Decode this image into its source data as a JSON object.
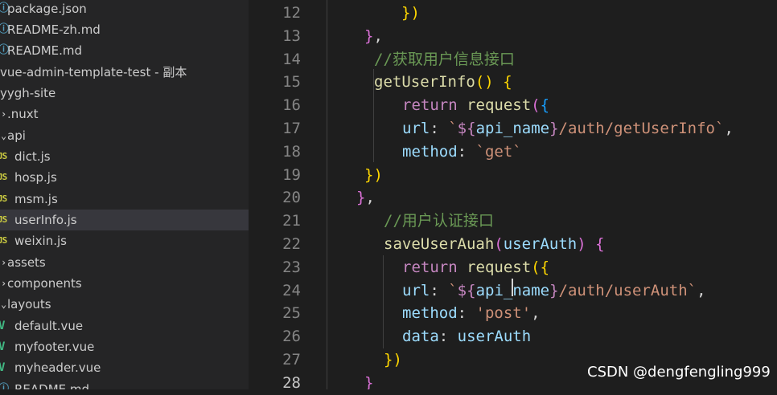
{
  "explorer": {
    "items": [
      {
        "label": "package.json",
        "icon": "info-icon",
        "selected": false
      },
      {
        "label": "README-zh.md",
        "icon": "info-icon",
        "selected": false
      },
      {
        "label": "README.md",
        "icon": "info-icon",
        "selected": false
      },
      {
        "label": "vue-admin-template-test - 副本",
        "icon": "",
        "selected": false
      },
      {
        "label": "yygh-site",
        "icon": "",
        "selected": false
      },
      {
        "label": ".nuxt",
        "icon": "chevron-right-icon",
        "selected": false
      },
      {
        "label": "api",
        "icon": "chevron-down-icon",
        "selected": false
      },
      {
        "label": "dict.js",
        "icon": "js-icon",
        "selected": false
      },
      {
        "label": "hosp.js",
        "icon": "js-icon",
        "selected": false
      },
      {
        "label": "msm.js",
        "icon": "js-icon",
        "selected": false
      },
      {
        "label": "userInfo.js",
        "icon": "js-icon",
        "selected": true
      },
      {
        "label": "weixin.js",
        "icon": "js-icon",
        "selected": false
      },
      {
        "label": "assets",
        "icon": "chevron-right-icon",
        "selected": false
      },
      {
        "label": "components",
        "icon": "chevron-right-icon",
        "selected": false
      },
      {
        "label": "layouts",
        "icon": "chevron-down-icon",
        "selected": false
      },
      {
        "label": "default.vue",
        "icon": "vue-icon",
        "selected": false
      },
      {
        "label": "myfooter.vue",
        "icon": "vue-icon",
        "selected": false
      },
      {
        "label": "myheader.vue",
        "icon": "vue-icon",
        "selected": false
      },
      {
        "label": "README.md",
        "icon": "info-icon",
        "selected": false
      }
    ]
  },
  "editor": {
    "active_line": "28",
    "lines": [
      {
        "num": "12",
        "tokens": [
          {
            "t": "})",
            "c": "b1"
          }
        ]
      },
      {
        "num": "13",
        "tokens": [
          {
            "t": "}",
            "c": "b2"
          },
          {
            "t": ",",
            "c": "p"
          }
        ]
      },
      {
        "num": "14",
        "tokens": [
          {
            "t": "//获取用户信息接口",
            "c": "cm"
          }
        ]
      },
      {
        "num": "15",
        "tokens": [
          {
            "t": "getUserInfo",
            "c": "fn"
          },
          {
            "t": "()",
            "c": "b1"
          },
          {
            "t": " ",
            "c": "p"
          },
          {
            "t": "{",
            "c": "b1"
          }
        ]
      },
      {
        "num": "16",
        "tokens": [
          {
            "t": "return",
            "c": "kw"
          },
          {
            "t": " ",
            "c": "p"
          },
          {
            "t": "request",
            "c": "fn"
          },
          {
            "t": "(",
            "c": "b2"
          },
          {
            "t": "{",
            "c": "b3"
          }
        ]
      },
      {
        "num": "17",
        "tokens": [
          {
            "t": "url",
            "c": "var"
          },
          {
            "t": ": ",
            "c": "p"
          },
          {
            "t": "`",
            "c": "str"
          },
          {
            "t": "${",
            "c": "kw"
          },
          {
            "t": "api_name",
            "c": "var"
          },
          {
            "t": "}",
            "c": "kw"
          },
          {
            "t": "/auth/getUserInfo`",
            "c": "str"
          },
          {
            "t": ",",
            "c": "p"
          }
        ]
      },
      {
        "num": "18",
        "tokens": [
          {
            "t": "method",
            "c": "var"
          },
          {
            "t": ": ",
            "c": "p"
          },
          {
            "t": "`get`",
            "c": "str"
          }
        ]
      },
      {
        "num": "19",
        "tokens": [
          {
            "t": "})",
            "c": "b1"
          }
        ]
      },
      {
        "num": "20",
        "tokens": [
          {
            "t": "}",
            "c": "b2"
          },
          {
            "t": ",",
            "c": "p"
          }
        ]
      },
      {
        "num": "21",
        "tokens": [
          {
            "t": "//用户认证接口",
            "c": "cm"
          }
        ]
      },
      {
        "num": "22",
        "tokens": [
          {
            "t": "saveUserAuah",
            "c": "fn"
          },
          {
            "t": "(",
            "c": "b2"
          },
          {
            "t": "userAuth",
            "c": "var"
          },
          {
            "t": ")",
            "c": "b2"
          },
          {
            "t": " ",
            "c": "p"
          },
          {
            "t": "{",
            "c": "b2"
          }
        ]
      },
      {
        "num": "23",
        "tokens": [
          {
            "t": "return",
            "c": "kw"
          },
          {
            "t": " ",
            "c": "p"
          },
          {
            "t": "request",
            "c": "fn"
          },
          {
            "t": "(",
            "c": "b1"
          },
          {
            "t": "{",
            "c": "b1"
          }
        ]
      },
      {
        "num": "24",
        "tokens": [
          {
            "t": "url",
            "c": "var"
          },
          {
            "t": ": ",
            "c": "p"
          },
          {
            "t": "`",
            "c": "str"
          },
          {
            "t": "${",
            "c": "kw"
          },
          {
            "t": "api_name",
            "c": "var"
          },
          {
            "t": "}",
            "c": "kw"
          },
          {
            "t": "/auth/userAuth`",
            "c": "str"
          },
          {
            "t": ",",
            "c": "p"
          }
        ]
      },
      {
        "num": "25",
        "tokens": [
          {
            "t": "method",
            "c": "var"
          },
          {
            "t": ": ",
            "c": "p"
          },
          {
            "t": "'post'",
            "c": "str"
          },
          {
            "t": ",",
            "c": "p"
          }
        ]
      },
      {
        "num": "26",
        "tokens": [
          {
            "t": "data",
            "c": "var"
          },
          {
            "t": ": ",
            "c": "p"
          },
          {
            "t": "userAuth",
            "c": "var"
          }
        ]
      },
      {
        "num": "27",
        "tokens": [
          {
            "t": "})",
            "c": "b1"
          }
        ]
      },
      {
        "num": "28",
        "tokens": [
          {
            "t": "}",
            "c": "b2"
          }
        ]
      }
    ]
  },
  "watermark": "CSDN @dengfengling999"
}
